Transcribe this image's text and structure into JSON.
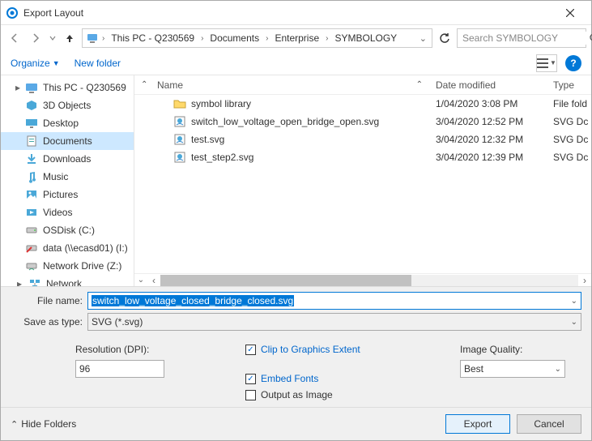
{
  "window": {
    "title": "Export Layout"
  },
  "breadcrumb": {
    "items": [
      "This PC - Q230569",
      "Documents",
      "Enterprise",
      "SYMBOLOGY"
    ]
  },
  "search": {
    "placeholder": "Search SYMBOLOGY"
  },
  "toolbar": {
    "organize": "Organize",
    "new_folder": "New folder"
  },
  "columns": {
    "name": "Name",
    "date": "Date modified",
    "type": "Type"
  },
  "nav": {
    "items": [
      {
        "label": "This PC - Q230569",
        "icon": "pc",
        "caret": true
      },
      {
        "label": "3D Objects",
        "icon": "3d"
      },
      {
        "label": "Desktop",
        "icon": "desktop"
      },
      {
        "label": "Documents",
        "icon": "docs",
        "selected": true
      },
      {
        "label": "Downloads",
        "icon": "downloads"
      },
      {
        "label": "Music",
        "icon": "music"
      },
      {
        "label": "Pictures",
        "icon": "pictures"
      },
      {
        "label": "Videos",
        "icon": "videos"
      },
      {
        "label": "OSDisk (C:)",
        "icon": "disk"
      },
      {
        "label": "data (\\\\ecasd01) (I:)",
        "icon": "netdrive-x"
      },
      {
        "label": "Network Drive (Z:)",
        "icon": "netdrive"
      },
      {
        "label": "Network",
        "icon": "network",
        "caret": true
      }
    ]
  },
  "files": [
    {
      "name": "symbol library",
      "icon": "folder",
      "date": "1/04/2020 3:08 PM",
      "type": "File fold"
    },
    {
      "name": "switch_low_voltage_open_bridge_open.svg",
      "icon": "svg",
      "date": "3/04/2020 12:52 PM",
      "type": "SVG Dc"
    },
    {
      "name": "test.svg",
      "icon": "svg",
      "date": "3/04/2020 12:32 PM",
      "type": "SVG Dc"
    },
    {
      "name": "test_step2.svg",
      "icon": "svg",
      "date": "3/04/2020 12:39 PM",
      "type": "SVG Dc"
    }
  ],
  "form": {
    "file_name_label": "File name:",
    "file_name_value": "switch_low_voltage_closed_bridge_closed.svg",
    "save_type_label": "Save as type:",
    "save_type_value": "SVG (*.svg)"
  },
  "options": {
    "resolution_label": "Resolution (DPI):",
    "resolution_value": "96",
    "clip_label": "Clip to Graphics Extent",
    "clip_checked": true,
    "embed_label": "Embed Fonts",
    "embed_checked": true,
    "output_label": "Output as Image",
    "output_checked": false,
    "quality_label": "Image Quality:",
    "quality_value": "Best"
  },
  "footer": {
    "hide_folders": "Hide Folders",
    "export": "Export",
    "cancel": "Cancel"
  }
}
